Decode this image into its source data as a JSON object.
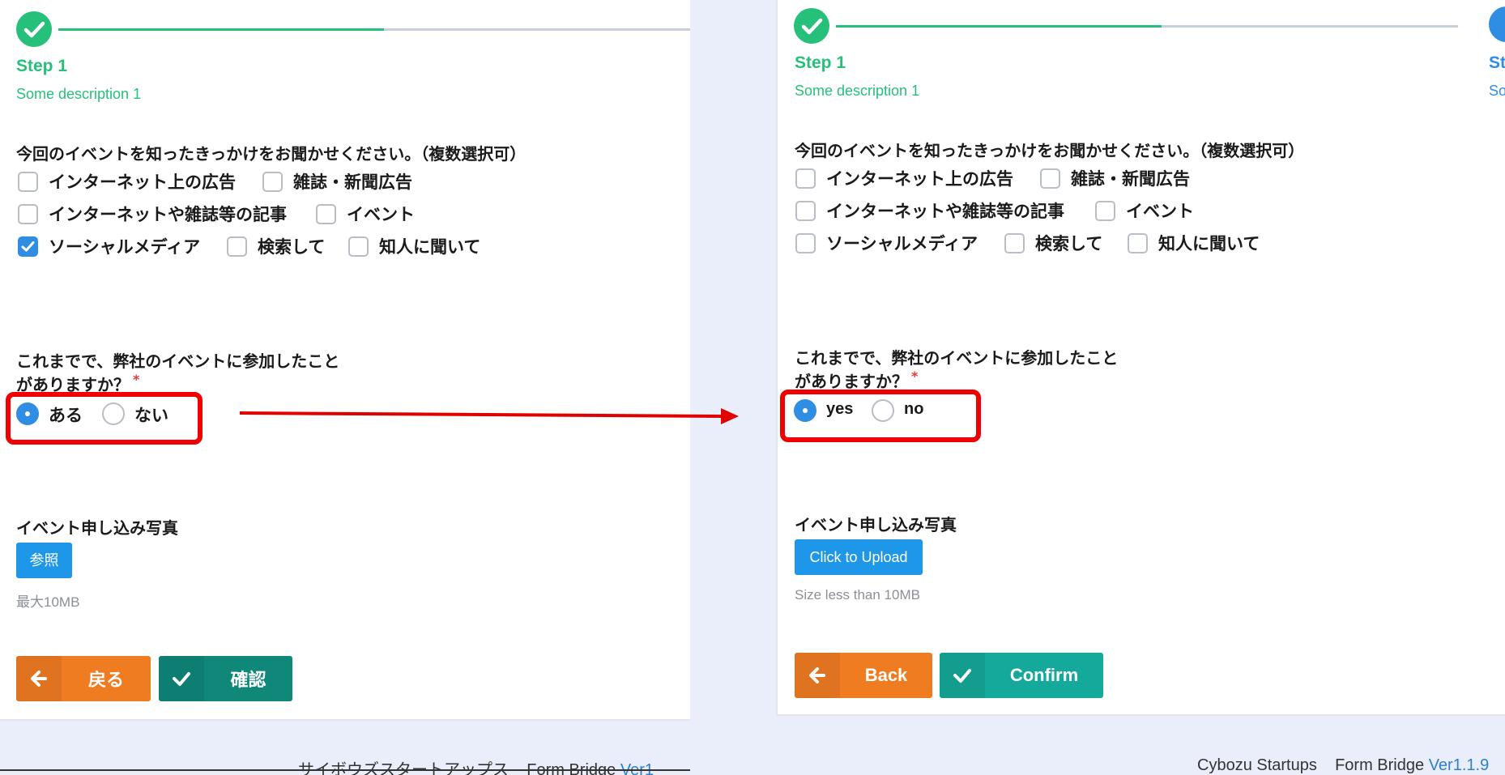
{
  "colors": {
    "green": "#27c07a",
    "blue": "#2f8de4",
    "orange": "#f07c22",
    "teal": "#14a99a",
    "teal_dark": "#0f887a",
    "red_annotation": "#f00000"
  },
  "left": {
    "step": {
      "title": "Step 1",
      "desc": "Some description 1"
    },
    "q1": {
      "text": "今回のイベントを知ったきっかけをお聞かせください。（複数選択可）",
      "options": [
        {
          "label": "インターネット上の広告",
          "checked": false
        },
        {
          "label": "雑誌・新聞広告",
          "checked": false
        },
        {
          "label": "インターネットや雑誌等の記事",
          "checked": false
        },
        {
          "label": "イベント",
          "checked": false
        },
        {
          "label": "ソーシャルメディア",
          "checked": true
        },
        {
          "label": "検索して",
          "checked": false
        },
        {
          "label": "知人に聞いて",
          "checked": false
        }
      ]
    },
    "q2": {
      "line1": "これまでで、弊社のイベントに参加したこと",
      "line2": "がありますか？",
      "required_mark": "*",
      "yes": "ある",
      "no": "ない"
    },
    "upload": {
      "label": "イベント申し込み写真",
      "button": "参照",
      "hint": "最大10MB"
    },
    "back": "戻る",
    "confirm": "確認",
    "footer": {
      "company": "サイボウズスタートアップス",
      "product": "Form Bridge",
      "version": "Ver1"
    }
  },
  "right": {
    "step": {
      "title": "Step 1",
      "desc": "Some description 1",
      "next_title": "St",
      "next_desc": "So"
    },
    "q1": {
      "text": "今回のイベントを知ったきっかけをお聞かせください。（複数選択可）",
      "options": [
        {
          "label": "インターネット上の広告",
          "checked": false
        },
        {
          "label": "雑誌・新聞広告",
          "checked": false
        },
        {
          "label": "インターネットや雑誌等の記事",
          "checked": false
        },
        {
          "label": "イベント",
          "checked": false
        },
        {
          "label": "ソーシャルメディア",
          "checked": false
        },
        {
          "label": "検索して",
          "checked": false
        },
        {
          "label": "知人に聞いて",
          "checked": false
        }
      ]
    },
    "q2": {
      "line1": "これまでで、弊社のイベントに参加したこと",
      "line2": "がありますか？",
      "required_mark": "*",
      "yes": "yes",
      "no": "no"
    },
    "upload": {
      "label": "イベント申し込み写真",
      "button": "Click to Upload",
      "hint": "Size less than 10MB"
    },
    "back": "Back",
    "confirm": "Confirm",
    "footer": {
      "company": "Cybozu Startups",
      "product": "Form Bridge",
      "version": "Ver1.1.9"
    }
  }
}
